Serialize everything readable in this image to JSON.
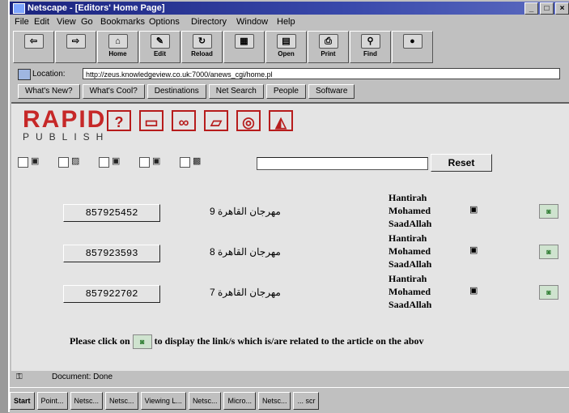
{
  "window": {
    "title": "Netscape - [Editors' Home Page]",
    "buttons": [
      "_",
      "□",
      "×"
    ]
  },
  "menu": [
    "File",
    "Edit",
    "View",
    "Go",
    "Bookmarks",
    "Options",
    "Directory",
    "Window",
    "Help"
  ],
  "toolbar": [
    {
      "label": "",
      "icon": "back-icon"
    },
    {
      "label": "",
      "icon": "forward-icon"
    },
    {
      "label": "Home",
      "icon": "home-icon"
    },
    {
      "label": "Edit",
      "icon": "edit-icon"
    },
    {
      "label": "Reload",
      "icon": "reload-icon"
    },
    {
      "label": "",
      "icon": "images-icon"
    },
    {
      "label": "Open",
      "icon": "open-icon"
    },
    {
      "label": "Print",
      "icon": "print-icon"
    },
    {
      "label": "Find",
      "icon": "find-icon"
    },
    {
      "label": "",
      "icon": "stop-icon"
    }
  ],
  "location": {
    "label": "Location:",
    "url": "http://zeus.knowledgeview.co.uk:7000/anews_cgi/home.pl"
  },
  "directory_buttons": [
    "What's New?",
    "What's Cool?",
    "Destinations",
    "Net Search",
    "People",
    "Software"
  ],
  "logo": {
    "word": "RAPID",
    "sub": "PUBLISH"
  },
  "logo_icons": [
    "help-icon",
    "screen-icon",
    "link-icon",
    "document-icon",
    "database-icon",
    "image-icon"
  ],
  "filter": {
    "reset_label": "Reset"
  },
  "rows": [
    {
      "id": "857925452",
      "title": "مهرجان القاهرة 9",
      "author": [
        "Hantirah",
        "Mohamed",
        "SaadAllah"
      ]
    },
    {
      "id": "857923593",
      "title": "مهرجان القاهرة 8",
      "author": [
        "Hantirah",
        "Mohamed",
        "SaadAllah"
      ]
    },
    {
      "id": "857922702",
      "title": "مهرجان القاهرة 7",
      "author": [
        "Hantirah",
        "Mohamed",
        "SaadAllah"
      ]
    }
  ],
  "note": {
    "before": "Please click on",
    "after": "to display the link/s which is/are related to the article on the abov"
  },
  "status": {
    "security": "",
    "text": "Document: Done"
  },
  "taskbar": [
    "Start",
    "Point...",
    "Netsc...",
    "Netsc...",
    "Viewing L...",
    "Netsc...",
    "Micro...",
    "Netsc...",
    "... scr"
  ]
}
